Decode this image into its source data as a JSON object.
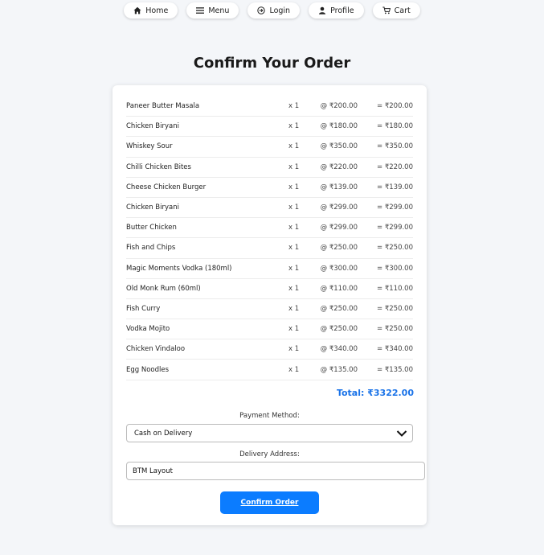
{
  "nav": [
    {
      "label": "Home",
      "icon": "home-icon"
    },
    {
      "label": "Menu",
      "icon": "menu-icon"
    },
    {
      "label": "Login",
      "icon": "login-icon"
    },
    {
      "label": "Profile",
      "icon": "profile-icon"
    },
    {
      "label": "Cart",
      "icon": "cart-icon"
    }
  ],
  "page": {
    "title": "Confirm Your Order"
  },
  "items": [
    {
      "name": "Paneer Butter Masala",
      "qty": "x 1",
      "price": "@ ₹200.00",
      "subtotal": "= ₹200.00"
    },
    {
      "name": "Chicken Biryani",
      "qty": "x 1",
      "price": "@ ₹180.00",
      "subtotal": "= ₹180.00"
    },
    {
      "name": "Whiskey Sour",
      "qty": "x 1",
      "price": "@ ₹350.00",
      "subtotal": "= ₹350.00"
    },
    {
      "name": "Chilli Chicken Bites",
      "qty": "x 1",
      "price": "@ ₹220.00",
      "subtotal": "= ₹220.00"
    },
    {
      "name": "Cheese Chicken Burger",
      "qty": "x 1",
      "price": "@ ₹139.00",
      "subtotal": "= ₹139.00"
    },
    {
      "name": "Chicken Biryani",
      "qty": "x 1",
      "price": "@ ₹299.00",
      "subtotal": "= ₹299.00"
    },
    {
      "name": "Butter Chicken",
      "qty": "x 1",
      "price": "@ ₹299.00",
      "subtotal": "= ₹299.00"
    },
    {
      "name": "Fish and Chips",
      "qty": "x 1",
      "price": "@ ₹250.00",
      "subtotal": "= ₹250.00"
    },
    {
      "name": "Magic Moments Vodka (180ml)",
      "qty": "x 1",
      "price": "@ ₹300.00",
      "subtotal": "= ₹300.00"
    },
    {
      "name": "Old Monk Rum (60ml)",
      "qty": "x 1",
      "price": "@ ₹110.00",
      "subtotal": "= ₹110.00"
    },
    {
      "name": "Fish Curry",
      "qty": "x 1",
      "price": "@ ₹250.00",
      "subtotal": "= ₹250.00"
    },
    {
      "name": "Vodka Mojito",
      "qty": "x 1",
      "price": "@ ₹250.00",
      "subtotal": "= ₹250.00"
    },
    {
      "name": "Chicken Vindaloo",
      "qty": "x 1",
      "price": "@ ₹340.00",
      "subtotal": "= ₹340.00"
    },
    {
      "name": "Egg Noodles",
      "qty": "x 1",
      "price": "@ ₹135.00",
      "subtotal": "= ₹135.00"
    }
  ],
  "total": "Total: ₹3322.00",
  "payment": {
    "label": "Payment Method:",
    "selected": "Cash on Delivery"
  },
  "delivery": {
    "label": "Delivery Address:",
    "value": "BTM Layout"
  },
  "confirm_label": "Confirm Order",
  "colors": {
    "accent": "#0b7cff",
    "total": "#1a73e8",
    "background": "#f4f6f9"
  }
}
